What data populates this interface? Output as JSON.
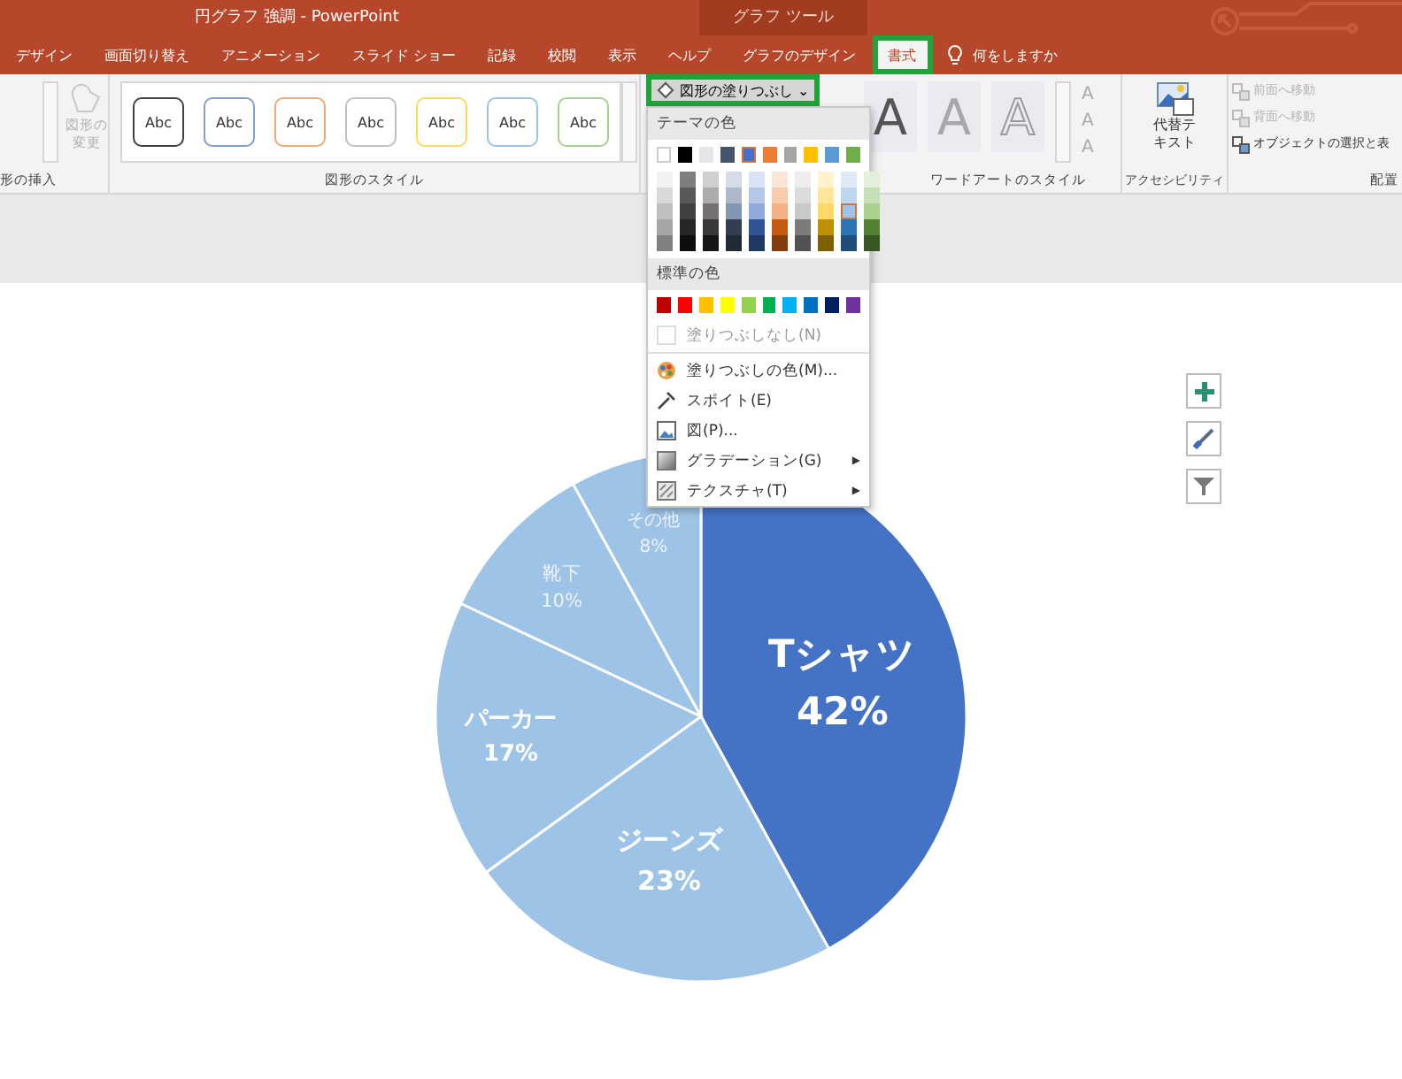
{
  "window": {
    "title": "円グラフ 強調 - PowerPoint",
    "context_title": "グラフ ツール"
  },
  "tabs": [
    {
      "label": "デザイン",
      "selected": false,
      "highlighted": false
    },
    {
      "label": "画面切り替え",
      "selected": false,
      "highlighted": false
    },
    {
      "label": "アニメーション",
      "selected": false,
      "highlighted": false
    },
    {
      "label": "スライド ショー",
      "selected": false,
      "highlighted": false
    },
    {
      "label": "記録",
      "selected": false,
      "highlighted": false
    },
    {
      "label": "校閲",
      "selected": false,
      "highlighted": false
    },
    {
      "label": "表示",
      "selected": false,
      "highlighted": false
    },
    {
      "label": "ヘルプ",
      "selected": false,
      "highlighted": false
    },
    {
      "label": "グラフのデザイン",
      "selected": false,
      "highlighted": false
    },
    {
      "label": "書式",
      "selected": true,
      "highlighted": true
    }
  ],
  "tell_me": "何をしますか",
  "ribbon": {
    "insert_shapes": {
      "label": "形の挿入",
      "change_shape": {
        "lines": [
          "図形の",
          "変更"
        ],
        "disabled": true
      }
    },
    "shape_styles": {
      "label": "図形のスタイル",
      "presets": [
        {
          "text": "Abc",
          "color": "#404040"
        },
        {
          "text": "Abc",
          "color": "#7f9fd0"
        },
        {
          "text": "Abc",
          "color": "#f0a878"
        },
        {
          "text": "Abc",
          "color": "#c0c0c0"
        },
        {
          "text": "Abc",
          "color": "#ffd860"
        },
        {
          "text": "Abc",
          "color": "#9cc3e6"
        },
        {
          "text": "Abc",
          "color": "#a9d18e"
        }
      ]
    },
    "shape_fill": {
      "label": "図形の塗りつぶし",
      "caret": "⌄",
      "highlighted": true
    },
    "wordart": {
      "label": "ワードアートのスタイル",
      "presets": [
        {
          "text": "A",
          "kind": "fill"
        },
        {
          "text": "A",
          "kind": "light"
        },
        {
          "text": "A",
          "kind": "outline"
        }
      ],
      "text_buttons": [
        {
          "text": "A"
        },
        {
          "text": "A"
        },
        {
          "text": "A"
        }
      ]
    },
    "accessibility": {
      "label": "アクセシビリティ",
      "alt_text": [
        "代替テ",
        "キスト"
      ]
    },
    "arrange": {
      "label": "配置",
      "items": [
        {
          "label": "前面へ移動",
          "disabled": true
        },
        {
          "label": "背面へ移動",
          "disabled": true
        },
        {
          "label": "オブジェクトの選択と表",
          "disabled": false
        }
      ]
    }
  },
  "fill_menu": {
    "theme_header": "テーマの色",
    "theme_colors": [
      {
        "color": "#ffffff",
        "selected": false,
        "shades": [
          {
            "color": "#f2f2f2",
            "selected": false
          },
          {
            "color": "#d9d9d9",
            "selected": false
          },
          {
            "color": "#bfbfbf",
            "selected": false
          },
          {
            "color": "#a6a6a6",
            "selected": false
          },
          {
            "color": "#808080",
            "selected": false
          }
        ]
      },
      {
        "color": "#000000",
        "selected": false,
        "shades": [
          {
            "color": "#7f7f7f",
            "selected": false
          },
          {
            "color": "#595959",
            "selected": false
          },
          {
            "color": "#404040",
            "selected": false
          },
          {
            "color": "#262626",
            "selected": false
          },
          {
            "color": "#0d0d0d",
            "selected": false
          }
        ]
      },
      {
        "color": "#e7e6e6",
        "selected": false,
        "shades": [
          {
            "color": "#d0cece",
            "selected": false
          },
          {
            "color": "#aeabab",
            "selected": false
          },
          {
            "color": "#757171",
            "selected": false
          },
          {
            "color": "#3a3838",
            "selected": false
          },
          {
            "color": "#171616",
            "selected": false
          }
        ]
      },
      {
        "color": "#44546a",
        "selected": false,
        "shades": [
          {
            "color": "#d6dce5",
            "selected": false
          },
          {
            "color": "#adb9ca",
            "selected": false
          },
          {
            "color": "#8497b0",
            "selected": false
          },
          {
            "color": "#333f50",
            "selected": false
          },
          {
            "color": "#222a35",
            "selected": false
          }
        ]
      },
      {
        "color": "#4472c4",
        "selected": true,
        "shades": [
          {
            "color": "#dae3f3",
            "selected": false
          },
          {
            "color": "#b4c7e7",
            "selected": false
          },
          {
            "color": "#8faadc",
            "selected": false
          },
          {
            "color": "#2f5597",
            "selected": false
          },
          {
            "color": "#203864",
            "selected": false
          }
        ]
      },
      {
        "color": "#ed7d31",
        "selected": false,
        "shades": [
          {
            "color": "#fbe5d6",
            "selected": false
          },
          {
            "color": "#f8cbad",
            "selected": false
          },
          {
            "color": "#f4b183",
            "selected": false
          },
          {
            "color": "#c55a11",
            "selected": false
          },
          {
            "color": "#843c0c",
            "selected": false
          }
        ]
      },
      {
        "color": "#a5a5a5",
        "selected": false,
        "shades": [
          {
            "color": "#ededed",
            "selected": false
          },
          {
            "color": "#dbdbdb",
            "selected": false
          },
          {
            "color": "#c9c9c9",
            "selected": false
          },
          {
            "color": "#7b7b7b",
            "selected": false
          },
          {
            "color": "#525252",
            "selected": false
          }
        ]
      },
      {
        "color": "#ffc000",
        "selected": false,
        "shades": [
          {
            "color": "#fff2cc",
            "selected": false
          },
          {
            "color": "#ffe699",
            "selected": false
          },
          {
            "color": "#ffd966",
            "selected": false
          },
          {
            "color": "#bf9000",
            "selected": false
          },
          {
            "color": "#7f6000",
            "selected": false
          }
        ]
      },
      {
        "color": "#5b9bd5",
        "selected": false,
        "shades": [
          {
            "color": "#deebf7",
            "selected": false
          },
          {
            "color": "#bdd7ee",
            "selected": false
          },
          {
            "color": "#9dc3e6",
            "selected": true
          },
          {
            "color": "#2e75b6",
            "selected": false
          },
          {
            "color": "#1f4e79",
            "selected": false
          }
        ]
      },
      {
        "color": "#70ad47",
        "selected": false,
        "shades": [
          {
            "color": "#e2f0d9",
            "selected": false
          },
          {
            "color": "#c5e0b4",
            "selected": false
          },
          {
            "color": "#a9d18e",
            "selected": false
          },
          {
            "color": "#548235",
            "selected": false
          },
          {
            "color": "#385723",
            "selected": false
          }
        ]
      }
    ],
    "standard_header": "標準の色",
    "standard_colors": [
      {
        "color": "#c00000"
      },
      {
        "color": "#ff0000"
      },
      {
        "color": "#ffc000"
      },
      {
        "color": "#ffff00"
      },
      {
        "color": "#92d050"
      },
      {
        "color": "#00b050"
      },
      {
        "color": "#00b0f0"
      },
      {
        "color": "#0070c0"
      },
      {
        "color": "#002060"
      },
      {
        "color": "#7030a0"
      }
    ],
    "no_fill": {
      "label": "塗りつぶしなし(N)",
      "disabled": true
    },
    "items": [
      {
        "kind": "palette",
        "label": "塗りつぶしの色(M)..."
      },
      {
        "kind": "eyedropper",
        "label": "スポイト(E)"
      },
      {
        "kind": "picture",
        "label": "図(P)..."
      },
      {
        "kind": "gradient",
        "label": "グラデーション(G)",
        "arrow": "▶"
      },
      {
        "kind": "texture",
        "label": "テクスチャ(T)",
        "arrow": "▶"
      }
    ]
  },
  "chart": {
    "chart_data": {
      "type": "pie",
      "categories": [
        "Tシャツ",
        "ジーンズ",
        "パーカー",
        "靴下",
        "その他"
      ],
      "values": [
        42,
        23,
        17,
        10,
        8
      ],
      "colors": [
        "#4472c4",
        "#9dc3e6",
        "#9dc3e6",
        "#9dc3e6",
        "#9dc3e6"
      ],
      "data_labels": true,
      "value_labels": [
        "42%",
        "23%",
        "17%",
        "10%",
        "8%"
      ]
    },
    "side_buttons": [
      {
        "kind": "plus"
      },
      {
        "kind": "brush"
      },
      {
        "kind": "filter"
      }
    ]
  }
}
